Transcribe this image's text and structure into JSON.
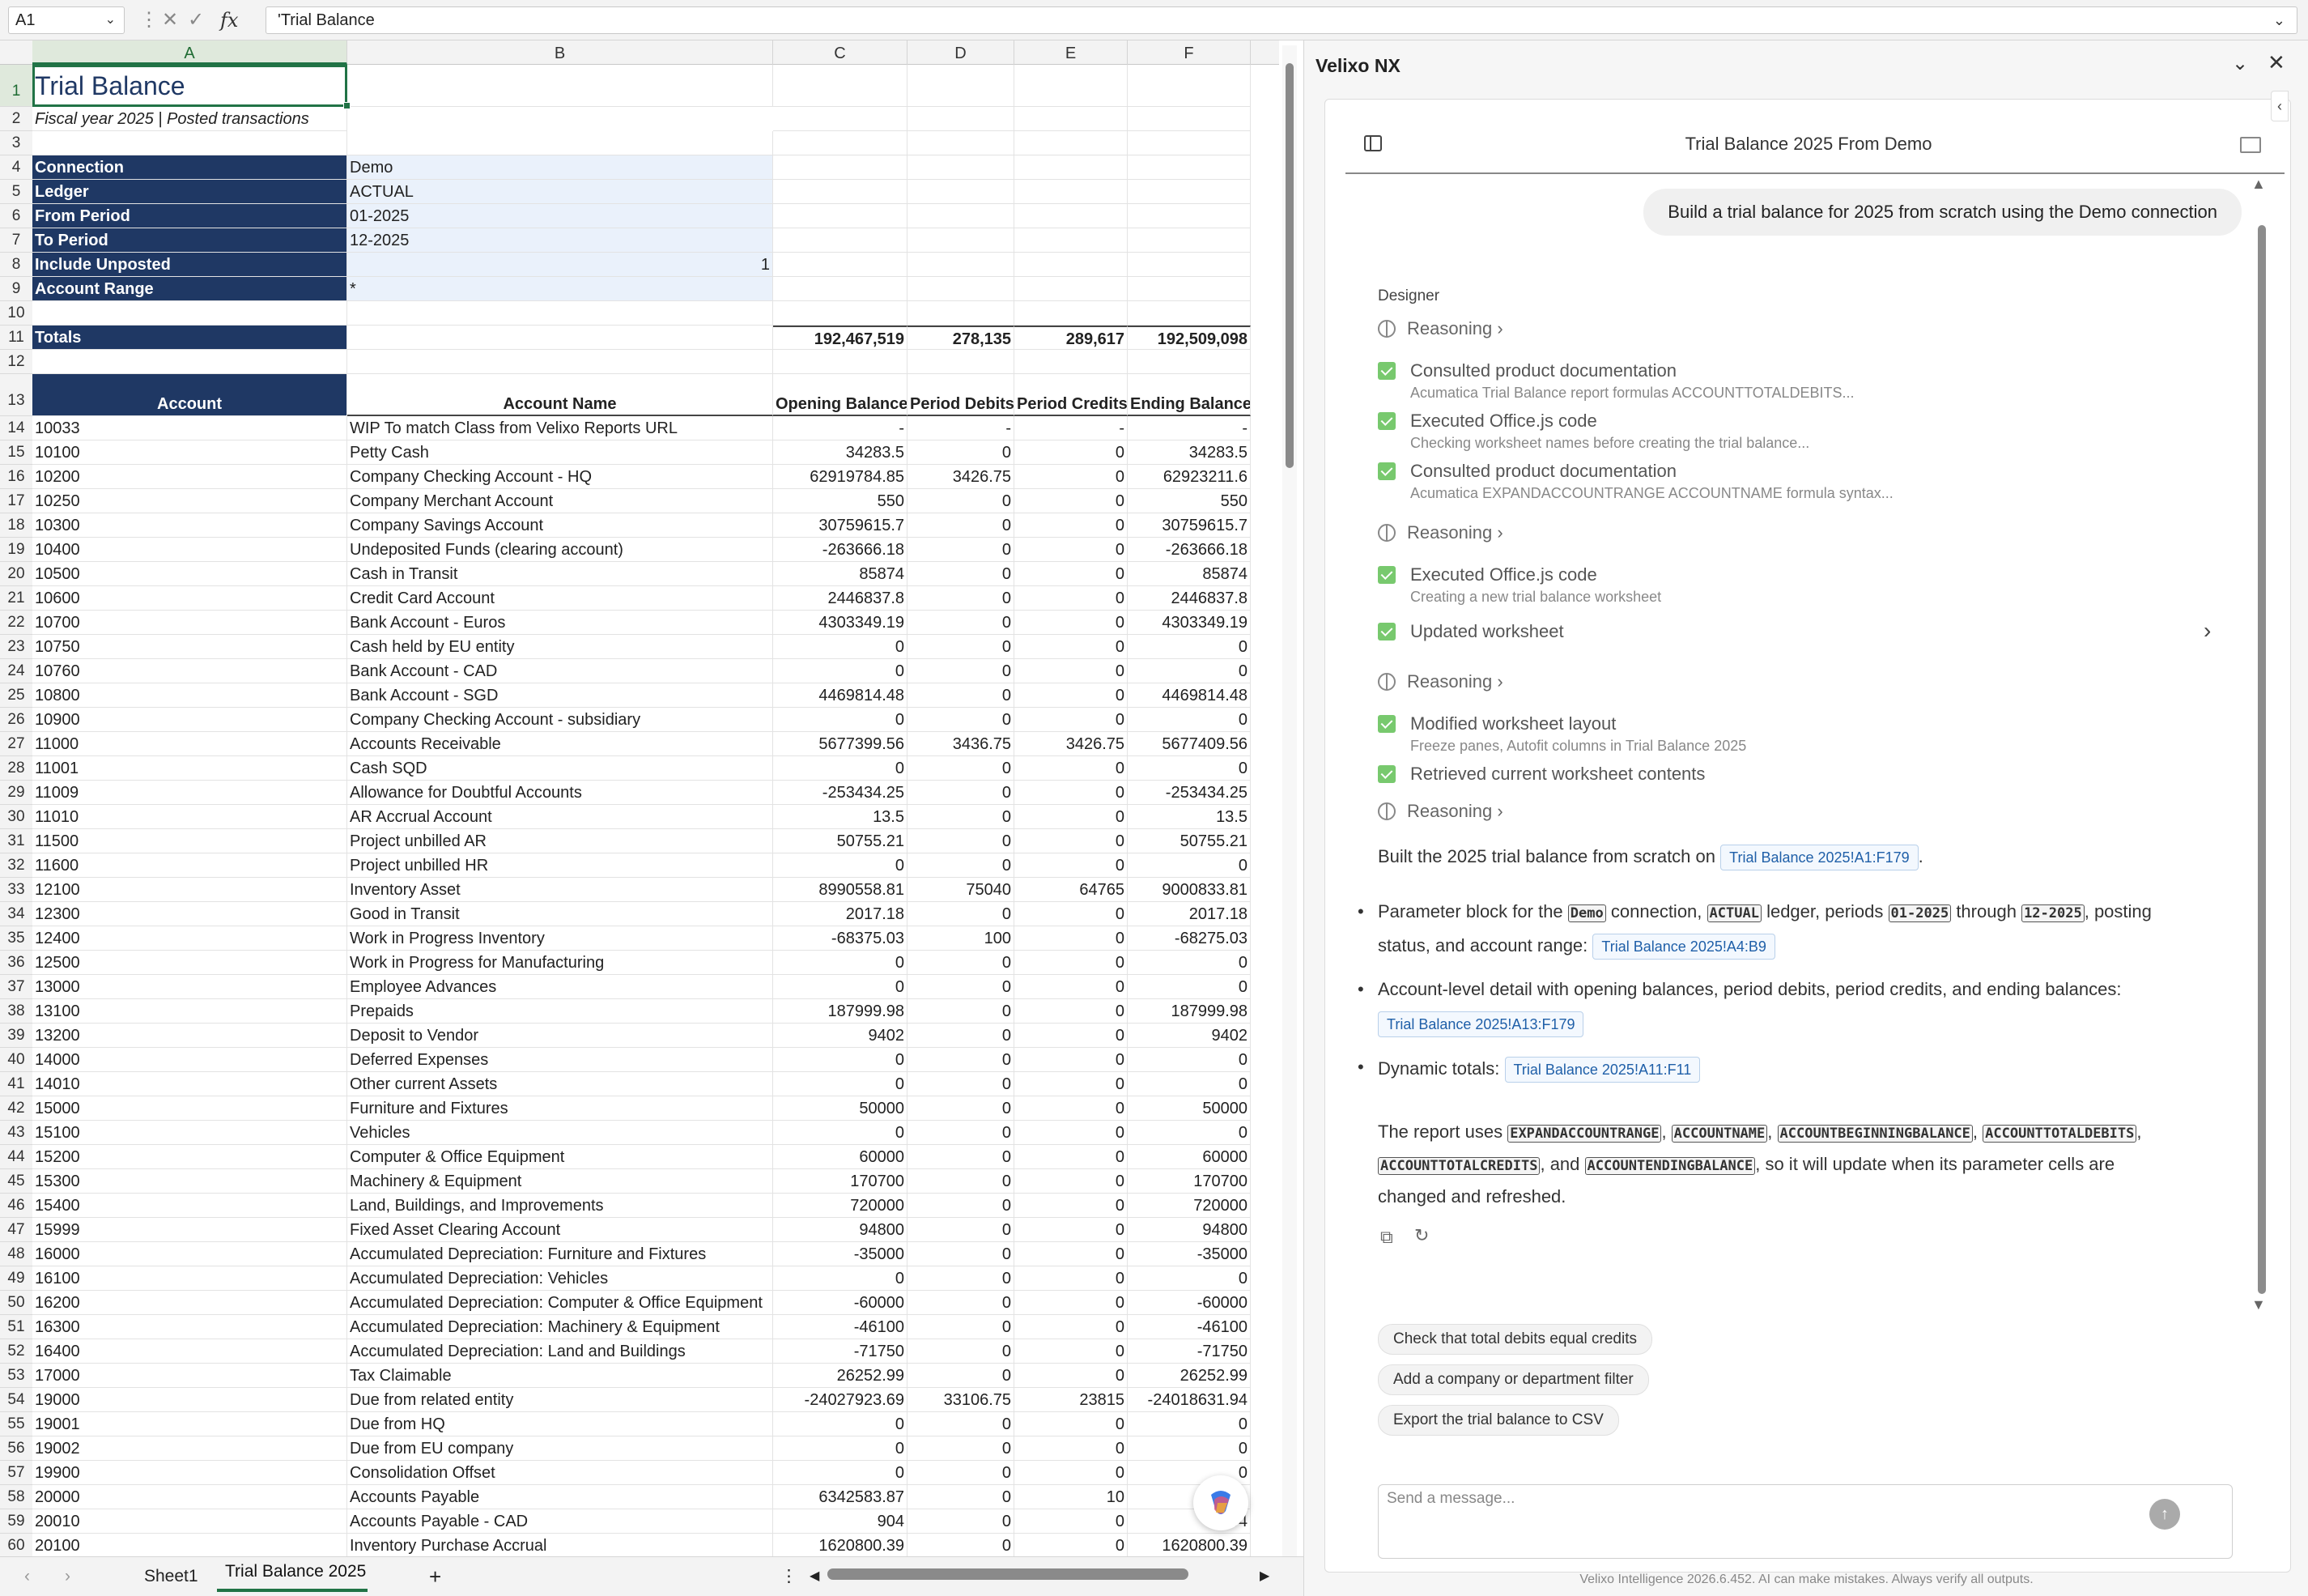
{
  "formula_bar": {
    "name_box": "A1",
    "formula": "'Trial Balance"
  },
  "columns": [
    "A",
    "B",
    "C",
    "D",
    "E",
    "F"
  ],
  "sheet": {
    "title": "Trial Balance",
    "subtitle": "Fiscal year 2025 | Posted transactions",
    "params": [
      {
        "label": "Connection",
        "value": "Demo"
      },
      {
        "label": "Ledger",
        "value": "ACTUAL"
      },
      {
        "label": "From Period",
        "value": "01-2025"
      },
      {
        "label": "To Period",
        "value": "12-2025"
      },
      {
        "label": "Include Unposted",
        "value": "1"
      },
      {
        "label": "Account Range",
        "value": "*"
      }
    ],
    "totals_label": "Totals",
    "totals": [
      "192,467,519",
      "278,135",
      "289,617",
      "192,509,098"
    ],
    "headers": [
      "Account",
      "Account Name",
      "Opening Balance",
      "Period Debits",
      "Period Credits",
      "Ending Balance"
    ],
    "rows": [
      [
        "10033",
        "WIP To match Class from Velixo Reports URL",
        "-",
        "-",
        "-",
        "-"
      ],
      [
        "10100",
        "Petty Cash",
        "34283.5",
        "0",
        "0",
        "34283.5"
      ],
      [
        "10200",
        "Company Checking Account - HQ",
        "62919784.85",
        "3426.75",
        "0",
        "62923211.6"
      ],
      [
        "10250",
        "Company Merchant Account",
        "550",
        "0",
        "0",
        "550"
      ],
      [
        "10300",
        "Company Savings Account",
        "30759615.7",
        "0",
        "0",
        "30759615.7"
      ],
      [
        "10400",
        "Undeposited Funds (clearing account)",
        "-263666.18",
        "0",
        "0",
        "-263666.18"
      ],
      [
        "10500",
        "Cash in Transit",
        "85874",
        "0",
        "0",
        "85874"
      ],
      [
        "10600",
        "Credit Card Account",
        "2446837.8",
        "0",
        "0",
        "2446837.8"
      ],
      [
        "10700",
        "Bank Account - Euros",
        "4303349.19",
        "0",
        "0",
        "4303349.19"
      ],
      [
        "10750",
        "Cash held by EU entity",
        "0",
        "0",
        "0",
        "0"
      ],
      [
        "10760",
        "Bank Account - CAD",
        "0",
        "0",
        "0",
        "0"
      ],
      [
        "10800",
        "Bank Account - SGD",
        "4469814.48",
        "0",
        "0",
        "4469814.48"
      ],
      [
        "10900",
        "Company Checking Account - subsidiary",
        "0",
        "0",
        "0",
        "0"
      ],
      [
        "11000",
        "Accounts Receivable",
        "5677399.56",
        "3436.75",
        "3426.75",
        "5677409.56"
      ],
      [
        "11001",
        "Cash SQD",
        "0",
        "0",
        "0",
        "0"
      ],
      [
        "11009",
        "Allowance for Doubtful Accounts",
        "-253434.25",
        "0",
        "0",
        "-253434.25"
      ],
      [
        "11010",
        "AR Accrual Account",
        "13.5",
        "0",
        "0",
        "13.5"
      ],
      [
        "11500",
        "Project unbilled AR",
        "50755.21",
        "0",
        "0",
        "50755.21"
      ],
      [
        "11600",
        "Project unbilled HR",
        "0",
        "0",
        "0",
        "0"
      ],
      [
        "12100",
        "Inventory Asset",
        "8990558.81",
        "75040",
        "64765",
        "9000833.81"
      ],
      [
        "12300",
        "Good in Transit",
        "2017.18",
        "0",
        "0",
        "2017.18"
      ],
      [
        "12400",
        "Work in Progress Inventory",
        "-68375.03",
        "100",
        "0",
        "-68275.03"
      ],
      [
        "12500",
        "Work in Progress for Manufacturing",
        "0",
        "0",
        "0",
        "0"
      ],
      [
        "13000",
        "Employee Advances",
        "0",
        "0",
        "0",
        "0"
      ],
      [
        "13100",
        "Prepaids",
        "187999.98",
        "0",
        "0",
        "187999.98"
      ],
      [
        "13200",
        "Deposit to Vendor",
        "9402",
        "0",
        "0",
        "9402"
      ],
      [
        "14000",
        "Deferred Expenses",
        "0",
        "0",
        "0",
        "0"
      ],
      [
        "14010",
        "Other current Assets",
        "0",
        "0",
        "0",
        "0"
      ],
      [
        "15000",
        "Furniture and Fixtures",
        "50000",
        "0",
        "0",
        "50000"
      ],
      [
        "15100",
        "Vehicles",
        "0",
        "0",
        "0",
        "0"
      ],
      [
        "15200",
        "Computer & Office Equipment",
        "60000",
        "0",
        "0",
        "60000"
      ],
      [
        "15300",
        "Machinery & Equipment",
        "170700",
        "0",
        "0",
        "170700"
      ],
      [
        "15400",
        "Land, Buildings, and Improvements",
        "720000",
        "0",
        "0",
        "720000"
      ],
      [
        "15999",
        "Fixed Asset Clearing Account",
        "94800",
        "0",
        "0",
        "94800"
      ],
      [
        "16000",
        "Accumulated Depreciation: Furniture and Fixtures",
        "-35000",
        "0",
        "0",
        "-35000"
      ],
      [
        "16100",
        "Accumulated Depreciation: Vehicles",
        "0",
        "0",
        "0",
        "0"
      ],
      [
        "16200",
        "Accumulated Depreciation: Computer & Office Equipment",
        "-60000",
        "0",
        "0",
        "-60000"
      ],
      [
        "16300",
        "Accumulated Depreciation: Machinery & Equipment",
        "-46100",
        "0",
        "0",
        "-46100"
      ],
      [
        "16400",
        "Accumulated Depreciation: Land and Buildings",
        "-71750",
        "0",
        "0",
        "-71750"
      ],
      [
        "17000",
        "Tax Claimable",
        "26252.99",
        "0",
        "0",
        "26252.99"
      ],
      [
        "19000",
        "Due from related entity",
        "-24027923.69",
        "33106.75",
        "23815",
        "-24018631.94"
      ],
      [
        "19001",
        "Due from HQ",
        "0",
        "0",
        "0",
        "0"
      ],
      [
        "19002",
        "Due from EU company",
        "0",
        "0",
        "0",
        "0"
      ],
      [
        "19900",
        "Consolidation Offset",
        "0",
        "0",
        "0",
        "0"
      ],
      [
        "20000",
        "Accounts Payable",
        "6342583.87",
        "0",
        "10",
        "6342"
      ],
      [
        "20010",
        "Accounts Payable - CAD",
        "904",
        "0",
        "0",
        "904"
      ],
      [
        "20100",
        "Inventory Purchase Accrual",
        "1620800.39",
        "0",
        "0",
        "1620800.39"
      ]
    ]
  },
  "tabs": {
    "sheet1": "Sheet1",
    "active": "Trial Balance 2025",
    "add": "+",
    "menu": "⋮",
    "prev": "‹",
    "next": "›"
  },
  "panel": {
    "title": "Velixo NX",
    "chat_title": "Trial Balance 2025 From Demo",
    "user_message": "Build a trial balance for 2025 from scratch using the Demo connection",
    "designer_label": "Designer",
    "reasoning_label": "Reasoning",
    "steps": [
      {
        "title": "Consulted product documentation",
        "sub": "Acumatica Trial Balance report formulas ACCOUNTTOTALDEBITS..."
      },
      {
        "title": "Executed Office.js code",
        "sub": "Checking worksheet names before creating the trial balance..."
      },
      {
        "title": "Consulted product documentation",
        "sub": "Acumatica EXPANDACCOUNTRANGE ACCOUNTNAME formula syntax..."
      },
      {
        "title": "Executed Office.js code",
        "sub": "Creating a new trial balance worksheet"
      },
      {
        "title": "Updated worksheet",
        "sub": ""
      },
      {
        "title": "Modified worksheet layout",
        "sub": "Freeze panes, Autofit columns in Trial Balance 2025"
      },
      {
        "title": "Retrieved current worksheet contents",
        "sub": ""
      }
    ],
    "summary": {
      "text": "Built the 2025 trial balance from scratch on",
      "ref": "Trial Balance 2025!A1:F179",
      "end": "."
    },
    "bullet1": {
      "a": "Parameter block for the",
      "c1": "Demo",
      "b": "connection,",
      "c2": "ACTUAL",
      "d": "ledger, periods",
      "c3": "01-2025",
      "e": "through",
      "c4": "12-2025",
      "f": ", posting",
      "g": "status, and account range:",
      "ref": "Trial Balance 2025!A4:B9"
    },
    "bullet2": {
      "a": "Account-level detail with opening balances, period debits, period credits, and ending balances:",
      "ref": "Trial Balance 2025!A13:F179"
    },
    "bullet3": {
      "a": "Dynamic totals:",
      "ref": "Trial Balance 2025!A11:F11"
    },
    "report": {
      "a": "The report uses",
      "f1": "EXPANDACCOUNTRANGE",
      "f2": "ACCOUNTNAME",
      "f3": "ACCOUNTBEGINNINGBALANCE",
      "f4": "ACCOUNTTOTALDEBITS",
      "f5": "ACCOUNTTOTALCREDITS",
      "and": ", and",
      "f6": "ACCOUNTENDINGBALANCE",
      "b": ", so it will update when its parameter cells are",
      "c": "changed and refreshed."
    },
    "suggestions": [
      "Check that total debits equal credits",
      "Add a company or department filter",
      "Export the trial balance to CSV"
    ],
    "composer_placeholder": "Send a message...",
    "footer": "Velixo Intelligence 2026.6.452. AI can make mistakes. Always verify all outputs."
  }
}
